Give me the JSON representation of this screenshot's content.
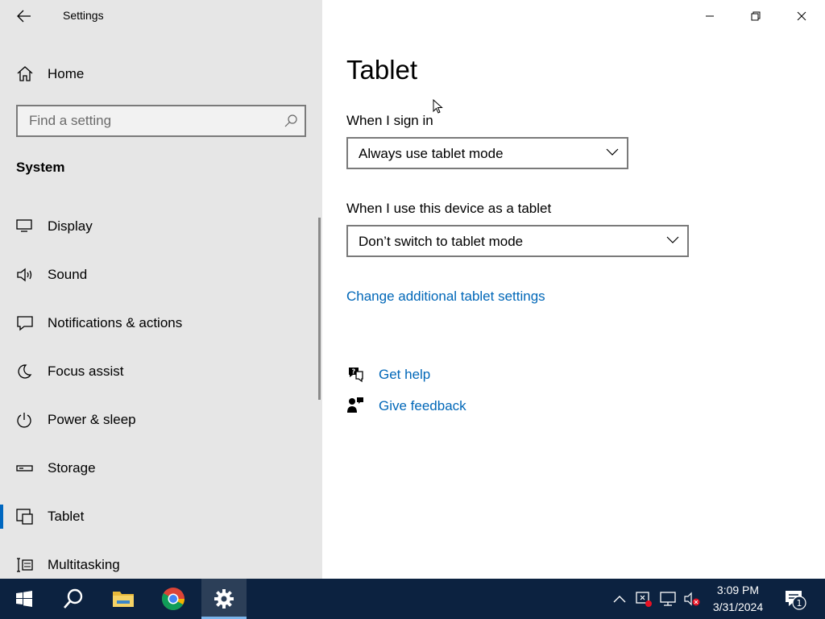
{
  "window": {
    "title": "Settings"
  },
  "sidebar": {
    "home_label": "Home",
    "search_placeholder": "Find a setting",
    "section_heading": "System",
    "items": [
      {
        "label": "Display",
        "icon": "display-icon",
        "selected": false
      },
      {
        "label": "Sound",
        "icon": "speaker-icon",
        "selected": false
      },
      {
        "label": "Notifications & actions",
        "icon": "notifications-icon",
        "selected": false
      },
      {
        "label": "Focus assist",
        "icon": "moon-icon",
        "selected": false
      },
      {
        "label": "Power & sleep",
        "icon": "power-icon",
        "selected": false
      },
      {
        "label": "Storage",
        "icon": "storage-icon",
        "selected": false
      },
      {
        "label": "Tablet",
        "icon": "tablet-icon",
        "selected": true
      },
      {
        "label": "Multitasking",
        "icon": "multitasking-icon",
        "selected": false
      }
    ]
  },
  "main": {
    "page_title": "Tablet",
    "sign_in": {
      "label": "When I sign in",
      "value": "Always use tablet mode"
    },
    "tablet_use": {
      "label": "When I use this device as a tablet",
      "value": "Don’t switch to tablet mode"
    },
    "additional_link": "Change additional tablet settings",
    "get_help": "Get help",
    "give_feedback": "Give feedback"
  },
  "taskbar": {
    "time": "3:09 PM",
    "date": "3/31/2024",
    "notification_count": "1"
  },
  "colors": {
    "accent": "#0067c0",
    "link": "#0067b8",
    "sidebar_bg": "#e6e6e6",
    "taskbar_bg": "#0c2240"
  }
}
